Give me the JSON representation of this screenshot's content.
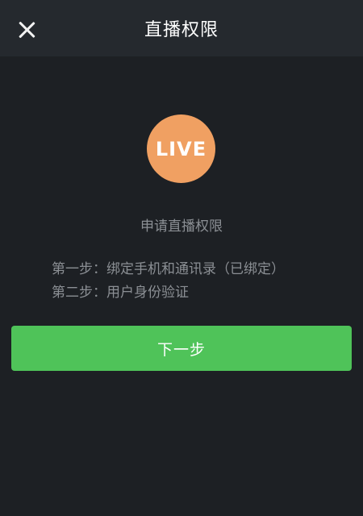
{
  "header": {
    "title": "直播权限",
    "close_icon": "close-icon"
  },
  "logo": {
    "text": "LIVE",
    "color": "#f0a062"
  },
  "main": {
    "apply_title": "申请直播权限",
    "steps": [
      "第一步：绑定手机和通讯录（已绑定）",
      "第二步：用户身份验证"
    ]
  },
  "actions": {
    "next_label": "下一步",
    "next_color": "#4fc359"
  }
}
